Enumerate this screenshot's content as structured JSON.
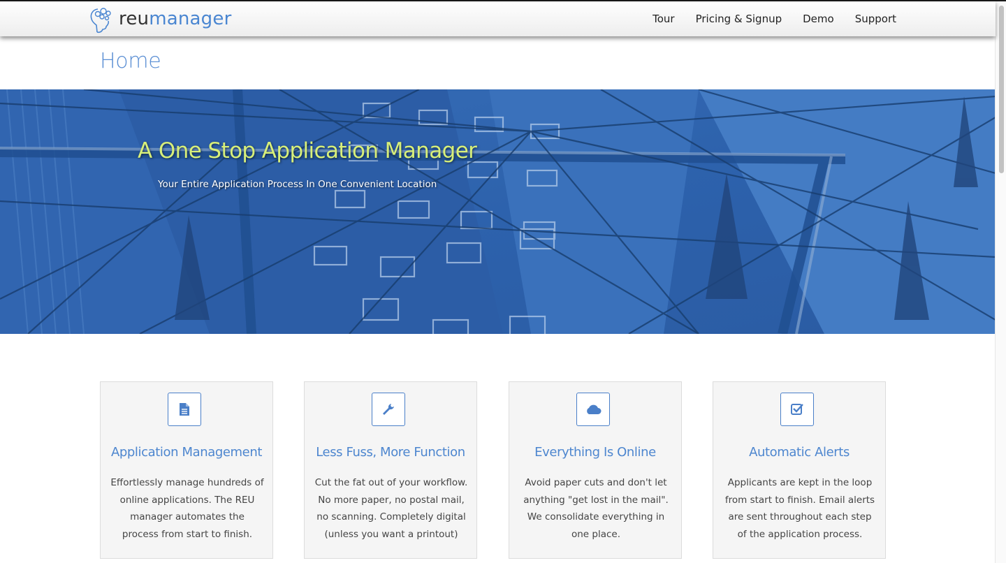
{
  "brand": {
    "part1": "reu",
    "part2": "manager"
  },
  "nav": [
    "Tour",
    "Pricing & Signup",
    "Demo",
    "Support"
  ],
  "page_title": "Home",
  "hero": {
    "title": "A One Stop Application Manager",
    "subtitle": "Your Entire Application Process In One Convenient Location"
  },
  "features": [
    {
      "icon": "file-icon",
      "title": "Application Management",
      "text": "Effortlessly manage hundreds of online applications. The REU manager automates the process from start to finish."
    },
    {
      "icon": "wrench-icon",
      "title": "Less Fuss, More Function",
      "text": "Cut the fat out of your workflow. No more paper, no postal mail, no scanning. Completely digital (unless you want a printout)"
    },
    {
      "icon": "cloud-icon",
      "title": "Everything Is Online",
      "text": "Avoid paper cuts and don't let anything \"get lost in the mail\". We consolidate everything in one place."
    },
    {
      "icon": "checkbox-icon",
      "title": "Automatic Alerts",
      "text": "Applicants are kept in the loop from start to finish. Email alerts are sent throughout each step of the application process."
    }
  ],
  "colors": {
    "accent": "#4a86d1",
    "hero_title": "#d7ef7a",
    "card_bg": "#f5f5f5"
  }
}
